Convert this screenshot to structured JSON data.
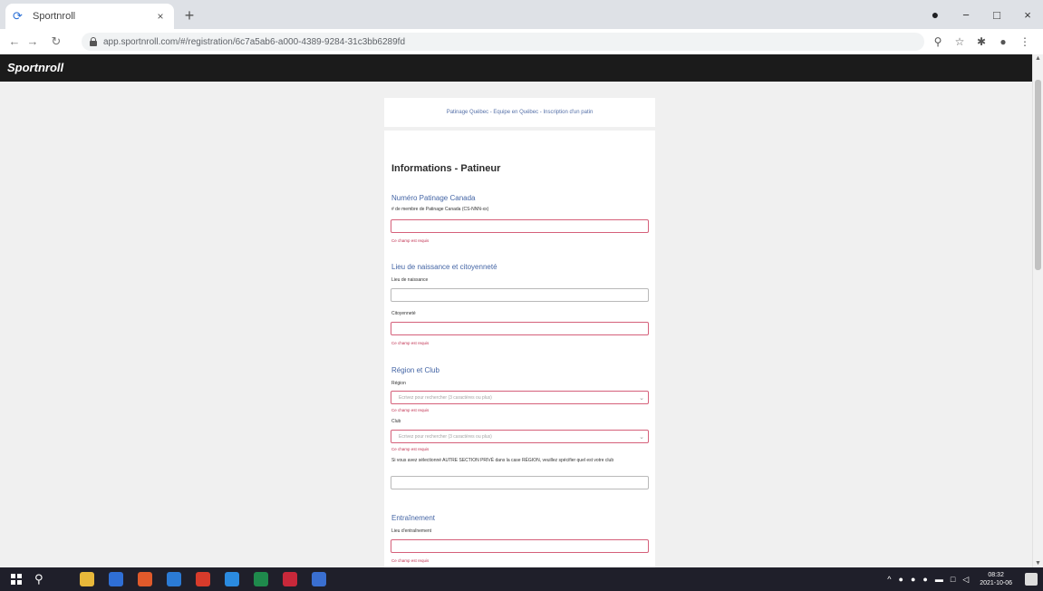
{
  "browser": {
    "tab_title": "Sportnroll",
    "tab_close": "×",
    "new_tab": "+",
    "url": "app.sportnroll.com/#/registration/6c7a5ab6-a000-4389-9284-31c3bb6289fd",
    "window_controls": {
      "minimize": "−",
      "maximize": "□",
      "close": "×"
    }
  },
  "app": {
    "logo": "Sportnroll"
  },
  "form": {
    "header": "Patinage Québec - Equipe en Québec - Inscription d'un patin",
    "title": "Informations - Patineur",
    "sections": {
      "skate_canada": {
        "title": "Numéro Patinage Canada",
        "label": "# de membre de Patinage Canada (CS-NNN-xx)",
        "error": "Ce champ est requis"
      },
      "birth": {
        "title": "Lieu de naissance et citoyenneté",
        "birthplace_label": "Lieu de naissance",
        "citizenship_label": "Citoyenneté",
        "citizenship_error": "Ce champ est requis"
      },
      "region_club": {
        "title": "Région et Club",
        "region_label": "Région",
        "region_placeholder": "Écrivez pour rechercher (3 caractères ou plus)",
        "region_error": "Ce champ est requis",
        "club_label": "Club",
        "club_placeholder": "Écrivez pour rechercher (3 caractères ou plus)",
        "club_error": "Ce champ est requis",
        "other_label": "Si vous avez sélectionné AUTRE SECTION PRIVÉ dans la case RÉGION, veuillez spécifier quel est votre club"
      },
      "training": {
        "title": "Entraînement",
        "label": "Lieu d'entraînement",
        "error": "Ce champ est requis"
      }
    }
  },
  "taskbar": {
    "time": "08:32",
    "date": "2021-10-06",
    "app_colors": [
      "#e8b83a",
      "#2f6fd6",
      "#e05a2b",
      "#2b7bd6",
      "#d83b2b",
      "#2b8be0",
      "#1f8a4c",
      "#c8283a",
      "#3a6fd0"
    ]
  }
}
